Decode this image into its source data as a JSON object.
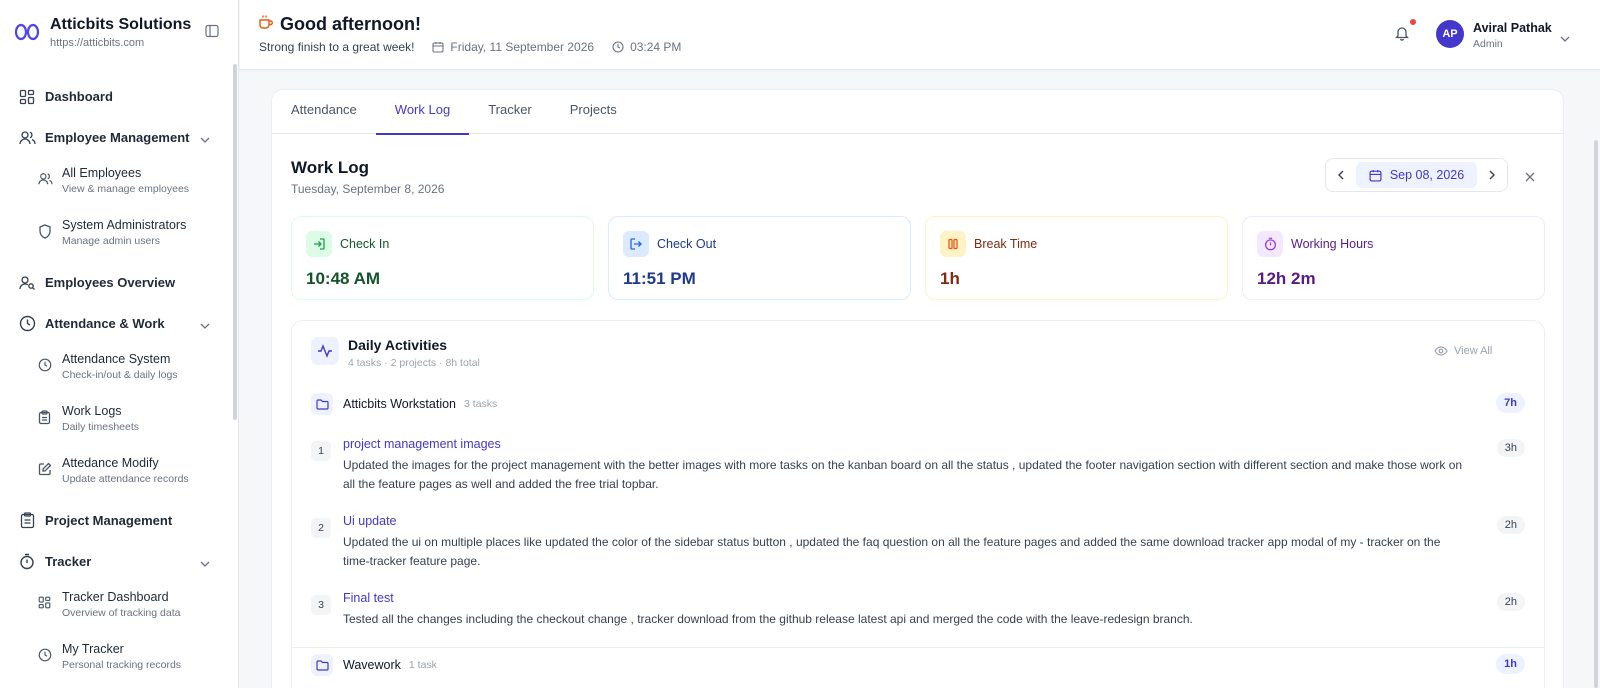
{
  "sidebar": {
    "brand_name": "Atticbits Solutions",
    "brand_url": "https://atticbits.com",
    "items": [
      {
        "label": "Dashboard"
      },
      {
        "label": "Employee Management"
      },
      {
        "label": "All Employees",
        "desc": "View & manage employees"
      },
      {
        "label": "System Administrators",
        "desc": "Manage admin users"
      },
      {
        "label": "Employees Overview"
      },
      {
        "label": "Attendance & Work"
      },
      {
        "label": "Attendance System",
        "desc": "Check-in/out & daily logs"
      },
      {
        "label": "Work Logs",
        "desc": "Daily timesheets"
      },
      {
        "label": "Attedance Modify",
        "desc": "Update attendance records"
      },
      {
        "label": "Project Management"
      },
      {
        "label": "Tracker"
      },
      {
        "label": "Tracker Dashboard",
        "desc": "Overview of tracking data"
      },
      {
        "label": "My Tracker",
        "desc": "Personal tracking records"
      }
    ]
  },
  "header": {
    "greeting": "Good afternoon!",
    "subtitle": "Strong finish to a great week!",
    "date": "Friday, 11 September 2026",
    "time": "03:24 PM",
    "user_initials": "AP",
    "user_name": "Aviral Pathak",
    "user_role": "Admin"
  },
  "tabs": [
    "Attendance",
    "Work Log",
    "Tracker",
    "Projects"
  ],
  "worklog": {
    "title": "Work Log",
    "date": "Tuesday, September 8, 2026",
    "selected_date": "Sep 08, 2026"
  },
  "stats": [
    {
      "label": "Check In",
      "value": "10:48 AM",
      "color": "#16a34a",
      "bg": "#dcfce7",
      "text": "#14532d"
    },
    {
      "label": "Check Out",
      "value": "11:51 PM",
      "color": "#2563eb",
      "bg": "#dbeafe",
      "text": "#1e3a8a"
    },
    {
      "label": "Break Time",
      "value": "1h",
      "color": "#d97706",
      "bg": "#fef3c7",
      "text": "#7c2d12"
    },
    {
      "label": "Working Hours",
      "value": "12h 2m",
      "color": "#9333ea",
      "bg": "#f3e8ff",
      "text": "#581c87"
    }
  ],
  "daily": {
    "title": "Daily Activities",
    "meta": "4 tasks · 2 projects · 8h total",
    "view_all": "View All",
    "projects": [
      {
        "name": "Atticbits Workstation",
        "count": "3 tasks",
        "hours": "7h",
        "tasks": [
          {
            "num": "1",
            "title": "project management images",
            "desc": "Updated the images for the project management with the better images with more tasks on the kanban board on all the status , updated the footer navigation section with different section and make those work on all the feature pages as well and added the free trial topbar.",
            "hours": "3h"
          },
          {
            "num": "2",
            "title": "Ui update",
            "desc": "Updated the ui on multiple places like updated the color of the sidebar status button , updated the faq question on all the feature pages and added the same download tracker app modal of my - tracker on the time-tracker feature page.",
            "hours": "2h"
          },
          {
            "num": "3",
            "title": "Final test",
            "desc": "Tested all the changes including the checkout change , tracker download from the github release latest api and merged the code with the leave-redesign branch.",
            "hours": "2h"
          }
        ]
      },
      {
        "name": "Wavework",
        "count": "1 task",
        "hours": "1h",
        "tasks": []
      }
    ]
  }
}
